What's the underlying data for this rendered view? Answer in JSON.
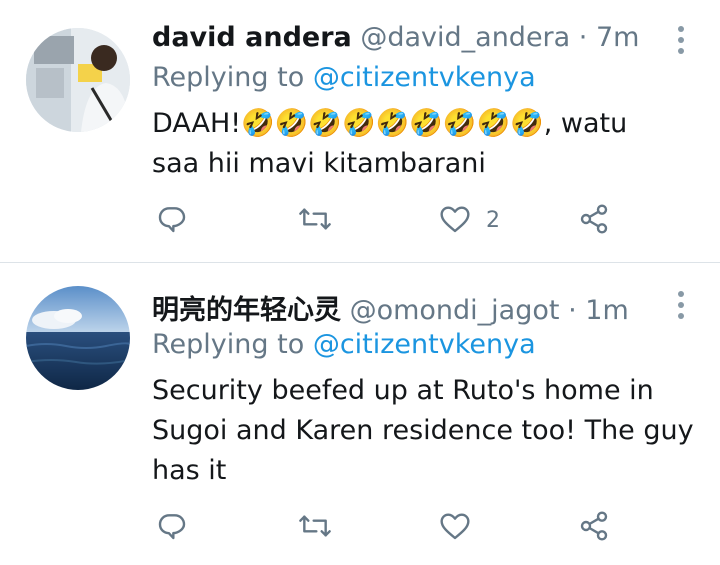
{
  "tweets": [
    {
      "name": "david andera",
      "handle": "@david_andera",
      "separator": "·",
      "time": "7m",
      "replying_prefix": "Replying to",
      "replying_handle": "@citizentvkenya",
      "text_line1_start": "DAAH!",
      "emoji": "🤣🤣🤣🤣🤣🤣🤣🤣🤣",
      "text_line1_end": ", watu",
      "text_line2": "saa hii mavi kitambarani",
      "like_count": "2"
    },
    {
      "name": "明亮的年轻心灵",
      "handle": "@omondi_jagot",
      "separator": "·",
      "time": "1m",
      "replying_prefix": "Replying to",
      "replying_handle": "@citizentvkenya",
      "text_line1": "Security beefed up at Ruto's home in",
      "text_line2": "Sugoi and Karen residence too! The guy",
      "text_line3": "has it"
    }
  ],
  "icons": {
    "reply": "reply-icon",
    "retweet": "retweet-icon",
    "like": "heart-icon",
    "share": "share-icon",
    "more": "more-icon"
  },
  "colors": {
    "text": "#14171a",
    "secondary": "#657786",
    "link": "#1b95e0",
    "divider": "#dde3e8"
  }
}
